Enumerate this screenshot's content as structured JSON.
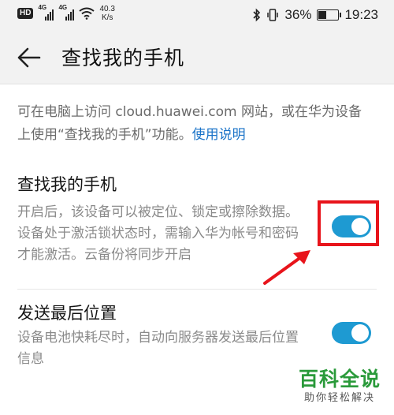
{
  "status_bar": {
    "hd_badge": "HD",
    "network1": "4G",
    "network2": "4G",
    "speed_value": "40.3",
    "speed_unit": "K/s",
    "battery_percent": "36%",
    "battery_level": 0.36,
    "time": "19:23",
    "icons": [
      "bluetooth-icon",
      "vibrate-icon",
      "battery-icon",
      "wifi-icon",
      "signal-icon"
    ]
  },
  "header": {
    "title": "查找我的手机",
    "back_icon": "back-arrow-icon"
  },
  "intro": {
    "text": "可在电脑上访问 cloud.huawei.com 网站，或在华为设备上使用“查找我的手机”功能。",
    "link_label": "使用说明"
  },
  "settings": [
    {
      "title": "查找我的手机",
      "description": "开启后，该设备可以被定位、锁定或擦除数据。设备处于激活锁状态时，需输入华为帐号和密码才能激活。云备份将同步开启",
      "enabled": true
    },
    {
      "title": "发送最后位置",
      "description": "设备电池快耗尽时，自动向服务器发送最后位置信息",
      "enabled": true
    }
  ],
  "colors": {
    "accent": "#1e9ad2",
    "link": "#1a73c8",
    "annotation": "#e8141b",
    "watermark": "#2a9a3a"
  },
  "watermark": {
    "title": "百科全说",
    "subtitle": "助你轻松解决"
  }
}
